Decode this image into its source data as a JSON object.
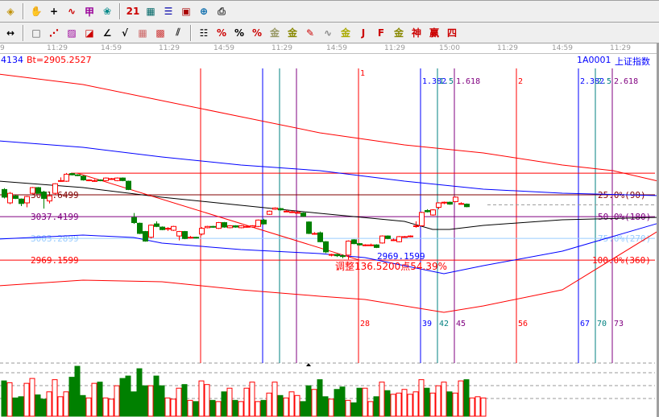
{
  "toolbar1": [
    {
      "name": "move-icon",
      "glyph": "◈",
      "color": "#c09000"
    },
    {
      "sep": true
    },
    {
      "name": "hand-icon",
      "glyph": "✋",
      "color": "#000"
    },
    {
      "name": "crosshair-icon",
      "glyph": "+",
      "color": "#000"
    },
    {
      "name": "line-select-icon",
      "glyph": "∿",
      "color": "#c00"
    },
    {
      "name": "pattern-icon",
      "glyph": "甲",
      "color": "#909"
    },
    {
      "name": "map-icon",
      "glyph": "❀",
      "color": "#088"
    },
    {
      "sep": true
    },
    {
      "name": "calendar-icon",
      "glyph": "21",
      "color": "#c00"
    },
    {
      "name": "calculator-icon",
      "glyph": "▦",
      "color": "#066"
    },
    {
      "name": "notepad-icon",
      "glyph": "☰",
      "color": "#00a"
    },
    {
      "name": "save-icon",
      "glyph": "▣",
      "color": "#a00"
    },
    {
      "name": "network-icon",
      "glyph": "⊕",
      "color": "#06a"
    },
    {
      "name": "print-icon",
      "glyph": "⎙",
      "color": "#333"
    }
  ],
  "toolbar2": [
    {
      "name": "fit-width-icon",
      "glyph": "↔",
      "color": "#000"
    },
    {
      "sep": true
    },
    {
      "name": "rect-tool-icon",
      "glyph": "□",
      "color": "#555"
    },
    {
      "name": "fan-lines-icon",
      "glyph": "⋰",
      "color": "#c00"
    },
    {
      "name": "gann-box-icon",
      "glyph": "▨",
      "color": "#909"
    },
    {
      "name": "gann-fan-icon",
      "glyph": "◪",
      "color": "#c00"
    },
    {
      "name": "angle-lines-icon",
      "glyph": "∠",
      "color": "#000"
    },
    {
      "name": "wave-icon",
      "glyph": "√",
      "color": "#000"
    },
    {
      "name": "grid-icon",
      "glyph": "▦",
      "color": "#c66"
    },
    {
      "name": "grid-arrow-icon",
      "glyph": "▩",
      "color": "#c33"
    },
    {
      "name": "parallel-lines-icon",
      "glyph": "⫽",
      "color": "#333"
    },
    {
      "sep": true
    },
    {
      "name": "fib-levels-icon",
      "glyph": "☷",
      "color": "#000"
    },
    {
      "name": "percent-line-icon",
      "glyph": "%",
      "color": "#c00"
    },
    {
      "name": "percent-icon",
      "glyph": "%",
      "color": "#000"
    },
    {
      "name": "percent-levels-icon",
      "glyph": "%",
      "color": "#c00"
    },
    {
      "name": "gold-circle-icon",
      "glyph": "金",
      "color": "#996"
    },
    {
      "name": "gold-levels-icon",
      "glyph": "金",
      "color": "#880"
    },
    {
      "name": "pen-icon",
      "glyph": "✎",
      "color": "#c00"
    },
    {
      "name": "sine-icon",
      "glyph": "∿",
      "color": "#888"
    },
    {
      "name": "gold-icon",
      "glyph": "金",
      "color": "#aa0"
    },
    {
      "name": "j-fan-icon",
      "glyph": "J",
      "color": "#c00"
    },
    {
      "name": "f-fan-icon",
      "glyph": "F",
      "color": "#c00"
    },
    {
      "name": "gold-fan-icon",
      "glyph": "金",
      "color": "#880"
    },
    {
      "name": "shen-fan-icon",
      "glyph": "神",
      "color": "#c00"
    },
    {
      "name": "ying-fan-icon",
      "glyph": "赢",
      "color": "#c00"
    },
    {
      "name": "four-fan-icon",
      "glyph": "四",
      "color": "#c00"
    }
  ],
  "time_axis": [
    "9",
    "11:29",
    "14:59",
    "11:29",
    "14:59",
    "11:29",
    "14:59",
    "11:29",
    "15:00",
    "11:29",
    "14:59",
    "11:29"
  ],
  "info": {
    "count": "4134",
    "bt": "Bt=2905.2527",
    "code": "1A0001",
    "name": "上证指数"
  },
  "colors": {
    "up": "#ff0000",
    "down": "#008000",
    "fib": [
      "#ff0000",
      "#0000ff",
      "#008080",
      "#800080"
    ]
  },
  "chart_data": {
    "type": "candlestick",
    "ylim": [
      2860,
      3280
    ],
    "levels": [
      {
        "price": 3105.6799,
        "label": "",
        "pct": "",
        "color": "#ff0000"
      },
      {
        "price": 3071.6499,
        "label": "3071.6499",
        "pct": "25.0%(90)",
        "color": "#800000"
      },
      {
        "price": 3037.4199,
        "label": "3037.4199",
        "pct": "50.0%(180)",
        "color": "#800080"
      },
      {
        "price": 3003.2899,
        "label": "3003.2899",
        "pct": "75.0%(270)",
        "color": "#99ccff"
      },
      {
        "price": 2969.1599,
        "label": "2969.1599",
        "pct": "100.0%(360)",
        "color": "#ff0000"
      }
    ],
    "current_price": 3056,
    "fib_time": {
      "start_bar": 35,
      "offsets": [
        0,
        11,
        14,
        17,
        28,
        39,
        42,
        45,
        56,
        67,
        70,
        73
      ],
      "top_labels": [
        "",
        "",
        "",
        "",
        "1",
        "1.382",
        "1.5",
        "1.618",
        "2",
        "2.382",
        "2.5",
        "2.618"
      ],
      "bottom_labels": [
        "",
        "",
        "",
        "",
        "28",
        "39",
        "42",
        "45",
        "56",
        "67",
        "70",
        "73"
      ]
    },
    "trendline": {
      "from": [
        13,
        3105.68
      ],
      "to": [
        63,
        2969.16
      ]
    },
    "low_label": "2969.1599",
    "retrace_label": "调整136.5200点54.39%",
    "candles": [
      [
        3080,
        3082,
        3066,
        3068
      ],
      [
        3059,
        3076,
        3057,
        3074
      ],
      [
        3070,
        3071,
        3065,
        3066
      ],
      [
        3065,
        3066,
        3054,
        3058
      ],
      [
        3059,
        3070,
        3052,
        3069
      ],
      [
        3074,
        3084,
        3073,
        3083
      ],
      [
        3083,
        3084,
        3073,
        3074
      ],
      [
        3076,
        3078,
        3050,
        3066
      ],
      [
        3062,
        3071,
        3058,
        3070
      ],
      [
        3074,
        3090,
        3072,
        3089
      ],
      [
        3093,
        3099,
        3092,
        3094
      ],
      [
        3093,
        3106,
        3092,
        3104
      ],
      [
        3105,
        3106,
        3102,
        3103
      ],
      [
        3103,
        3104,
        3101,
        3102
      ],
      [
        3101,
        3102,
        3094,
        3095
      ],
      [
        3094,
        3096,
        3093,
        3095
      ],
      [
        3094,
        3096,
        3092,
        3094
      ],
      [
        3095,
        3096,
        3093,
        3094
      ],
      [
        3094,
        3099,
        3093,
        3098
      ],
      [
        3097,
        3098,
        3095,
        3097
      ],
      [
        3094,
        3099,
        3093,
        3098
      ],
      [
        3098,
        3099,
        3093,
        3094
      ],
      [
        3093,
        3094,
        3079,
        3080
      ],
      [
        3036,
        3043,
        3026,
        3028
      ],
      [
        3027,
        3028,
        3010,
        3011
      ],
      [
        3014,
        3015,
        2998,
        2999
      ],
      [
        3005,
        3025,
        3003,
        3024
      ],
      [
        3026,
        3030,
        3021,
        3022
      ],
      [
        3021,
        3022,
        3016,
        3017
      ],
      [
        3018,
        3021,
        3015,
        3019
      ],
      [
        3016,
        3023,
        3015,
        3022
      ],
      [
        3007,
        3015,
        3000,
        3014
      ],
      [
        3014,
        3015,
        3002,
        3003
      ],
      [
        3005,
        3007,
        3003,
        3005
      ],
      [
        3005,
        3006,
        3003,
        3004
      ],
      [
        3010,
        3021,
        3008,
        3019
      ],
      [
        3020,
        3023,
        3019,
        3022
      ],
      [
        3022,
        3023,
        3020,
        3021
      ],
      [
        3019,
        3029,
        3018,
        3028
      ],
      [
        3028,
        3029,
        3020,
        3021
      ],
      [
        3020,
        3024,
        3019,
        3023
      ],
      [
        3023,
        3024,
        3020,
        3021
      ],
      [
        3020,
        3024,
        3019,
        3023
      ],
      [
        3022,
        3024,
        3020,
        3022
      ],
      [
        3021,
        3024,
        3020,
        3023
      ],
      [
        3022,
        3033,
        3021,
        3032
      ],
      [
        3032,
        3034,
        3025,
        3026
      ],
      [
        3041,
        3047,
        3040,
        3046
      ],
      [
        3049,
        3052,
        3048,
        3051
      ],
      [
        3050,
        3051,
        3047,
        3048
      ],
      [
        3046,
        3048,
        3045,
        3046
      ],
      [
        3045,
        3047,
        3043,
        3045
      ],
      [
        3044,
        3046,
        3043,
        3044
      ],
      [
        3043,
        3044,
        3037,
        3038
      ],
      [
        3029,
        3030,
        3010,
        3011
      ],
      [
        3010,
        3013,
        3009,
        3011
      ],
      [
        3012,
        3014,
        2997,
        2998
      ],
      [
        2998,
        2999,
        2980,
        2982
      ],
      [
        2977,
        2979,
        2975,
        2978
      ],
      [
        2978,
        2979,
        2974,
        2976
      ],
      [
        2976,
        2978,
        2972,
        2975
      ],
      [
        2977,
        3000,
        2970,
        2999
      ],
      [
        3001,
        3002,
        2994,
        2995
      ],
      [
        2995,
        2996,
        2992,
        2993
      ],
      [
        2992,
        2994,
        2991,
        2993
      ],
      [
        2993,
        2995,
        2991,
        2993
      ],
      [
        2993,
        2994,
        2988,
        2989
      ],
      [
        2996,
        3008,
        2995,
        3007
      ],
      [
        3007,
        3008,
        3002,
        3003
      ],
      [
        3001,
        3003,
        2999,
        3001
      ],
      [
        2998,
        3007,
        2997,
        3006
      ],
      [
        3005,
        3007,
        3004,
        3006
      ],
      [
        3006,
        3008,
        3005,
        3007
      ],
      [
        3023,
        3030,
        3020,
        3023
      ],
      [
        3023,
        3045,
        3022,
        3044
      ],
      [
        3047,
        3049,
        3044,
        3045
      ],
      [
        3040,
        3049,
        3039,
        3048
      ],
      [
        3052,
        3060,
        3049,
        3059
      ],
      [
        3059,
        3061,
        3057,
        3060
      ],
      [
        3060,
        3061,
        3056,
        3057
      ],
      [
        3061,
        3069,
        3060,
        3068
      ],
      [
        3058,
        3060,
        3057,
        3058
      ],
      [
        3057,
        3058,
        3052,
        3053
      ]
    ],
    "volume": [
      58,
      55,
      30,
      32,
      54,
      62,
      35,
      28,
      40,
      60,
      32,
      40,
      64,
      82,
      34,
      30,
      54,
      56,
      30,
      28,
      50,
      62,
      66,
      40,
      78,
      50,
      50,
      66,
      50,
      30,
      28,
      46,
      52,
      26,
      24,
      58,
      52,
      26,
      24,
      40,
      46,
      26,
      24,
      46,
      56,
      24,
      26,
      38,
      56,
      34,
      30,
      40,
      34,
      24,
      50,
      44,
      60,
      32,
      28,
      44,
      48,
      26,
      22,
      46,
      46,
      24,
      32,
      56,
      42,
      36,
      38,
      44,
      36,
      40,
      60,
      46,
      38,
      50,
      56,
      40,
      38,
      58,
      60,
      30,
      32,
      30
    ],
    "ma_lines": [
      {
        "name": "upper-band-red",
        "color": "#ff0000",
        "points": [
          [
            -1,
            3261.2
          ],
          [
            14,
            3244.8
          ],
          [
            28,
            3219.5
          ],
          [
            42,
            3194.3
          ],
          [
            56,
            3169.0
          ],
          [
            71,
            3150.0
          ],
          [
            85,
            3137.4
          ],
          [
            99,
            3118.4
          ],
          [
            108,
            3109.6
          ],
          [
            116,
            3093.1
          ]
        ]
      },
      {
        "name": "upper-band-blue",
        "color": "#0000ff",
        "points": [
          [
            -1,
            3156.3
          ],
          [
            14,
            3146.2
          ],
          [
            28,
            3131.1
          ],
          [
            42,
            3118.4
          ],
          [
            56,
            3109.6
          ],
          [
            71,
            3093.1
          ],
          [
            85,
            3080.5
          ],
          [
            99,
            3074.2
          ],
          [
            116,
            3070.4
          ]
        ]
      },
      {
        "name": "moving-average-black",
        "color": "#000000",
        "points": [
          [
            -1,
            3093.1
          ],
          [
            14,
            3083.0
          ],
          [
            28,
            3067.9
          ],
          [
            42,
            3055.2
          ],
          [
            56,
            3042.6
          ],
          [
            71,
            3029.9
          ],
          [
            76,
            3017.3
          ],
          [
            79,
            3017.3
          ],
          [
            85,
            3023.6
          ],
          [
            99,
            3032.5
          ],
          [
            116,
            3036.3
          ]
        ]
      },
      {
        "name": "lower-band-blue",
        "color": "#0000ff",
        "points": [
          [
            -1,
            3002.1
          ],
          [
            14,
            3008.4
          ],
          [
            23,
            3004.6
          ],
          [
            28,
            2995.8
          ],
          [
            42,
            2985.7
          ],
          [
            56,
            2979.4
          ],
          [
            64,
            2973.0
          ],
          [
            71,
            2960.4
          ],
          [
            78,
            2947.8
          ],
          [
            85,
            2960.4
          ],
          [
            99,
            2983.2
          ],
          [
            116,
            3027.0
          ]
        ]
      },
      {
        "name": "lower-band-red",
        "color": "#ff0000",
        "points": [
          [
            -1,
            2928.8
          ],
          [
            14,
            2937.6
          ],
          [
            28,
            2935.1
          ],
          [
            42,
            2922.5
          ],
          [
            56,
            2912.4
          ],
          [
            64,
            2907.3
          ],
          [
            71,
            2897.2
          ],
          [
            78,
            2887.1
          ],
          [
            85,
            2897.2
          ],
          [
            99,
            2922.5
          ],
          [
            116,
            3014.8
          ]
        ]
      }
    ]
  }
}
